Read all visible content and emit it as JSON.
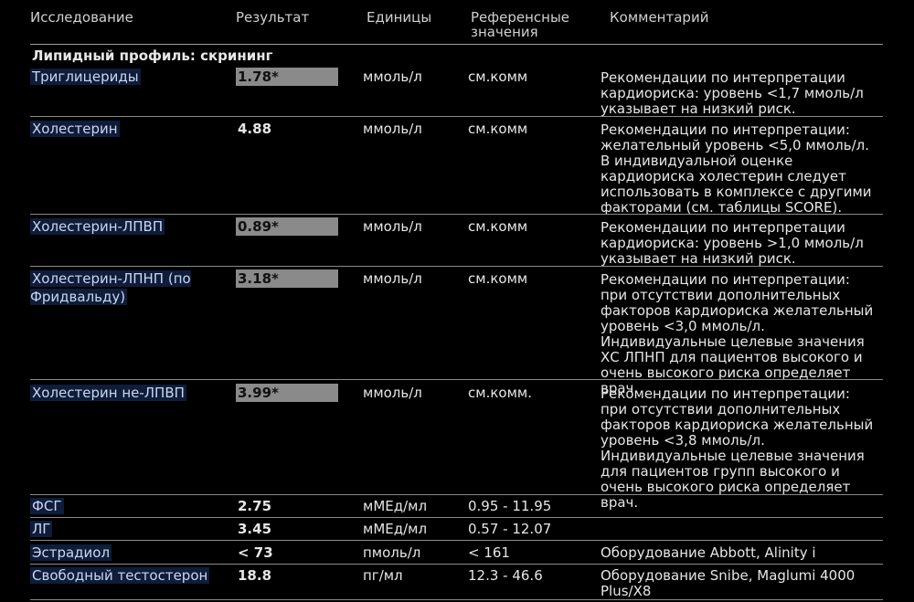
{
  "headers": {
    "study": "Исследование",
    "result": "Результат",
    "units": "Единицы",
    "reference_1": "Референсные",
    "reference_2": "значения",
    "comment": "Комментарий"
  },
  "section": {
    "title": "Липидный профиль: скрининг"
  },
  "rows": [
    {
      "name": "Триглицериды",
      "result": "1.78*",
      "flagged": true,
      "units": "ммоль/л",
      "reference": "см.комм",
      "comment": "Рекомендации по интерпретации кардиориска: уровень <1,7 ммоль/л указывает на низкий риск."
    },
    {
      "name": "Холестерин",
      "result": "4.88",
      "flagged": false,
      "units": "ммоль/л",
      "reference": "см.комм",
      "comment": "Рекомендации по интерпретации: желательный уровень <5,0 ммоль/л. В индивидуальной оценке кардиориска холестерин следует использовать в комплексе с другими факторами (см. таблицы SCORE)."
    },
    {
      "name": "Холестерин-ЛПВП",
      "result": "0.89*",
      "flagged": true,
      "units": "ммоль/л",
      "reference": "см.комм",
      "comment": "Рекомендации по интерпретации кардиориска: уровень >1,0 ммоль/л указывает на низкий риск."
    },
    {
      "name": "Холестерин-ЛПНП (по Фридвальду)",
      "result": "3.18*",
      "flagged": true,
      "units": "ммоль/л",
      "reference": "см.комм",
      "comment": "Рекомендации по интерпретации: при отсутствии дополнительных факторов кардиориска желательный уровень <3,0 ммоль/л. Индивидуальные целевые значения ХС ЛПНП для пациентов высокого и очень высокого риска определяет врач."
    },
    {
      "name": "Холестерин не-ЛПВП",
      "result": "3.99*",
      "flagged": true,
      "units": "ммоль/л",
      "reference": "см.комм.",
      "comment": "Рекомендации по интерпретации: при отсутствии дополнительных факторов кардиориска желательный уровень <3,8 ммоль/л. Индивидуальные целевые значения для пациентов групп высокого и очень высокого риска определяет врач."
    },
    {
      "name": "ФСГ",
      "result": "2.75",
      "flagged": false,
      "units": "мМЕд/мл",
      "reference": "0.95 - 11.95",
      "comment": ""
    },
    {
      "name": "ЛГ",
      "result": "3.45",
      "flagged": false,
      "units": "мМЕд/мл",
      "reference": "0.57 - 12.07",
      "comment": ""
    },
    {
      "name": "Эстрадиол",
      "result": "< 73",
      "flagged": false,
      "units": "пмоль/л",
      "reference": "< 161",
      "comment": "Оборудование Abbott, Alinity i"
    },
    {
      "name": "Свободный тестостерон",
      "result": "18.8",
      "flagged": false,
      "units": "пг/мл",
      "reference": "12.3 - 46.6",
      "comment": "Оборудование Snibe, Maglumi 4000 Plus/X8"
    }
  ]
}
